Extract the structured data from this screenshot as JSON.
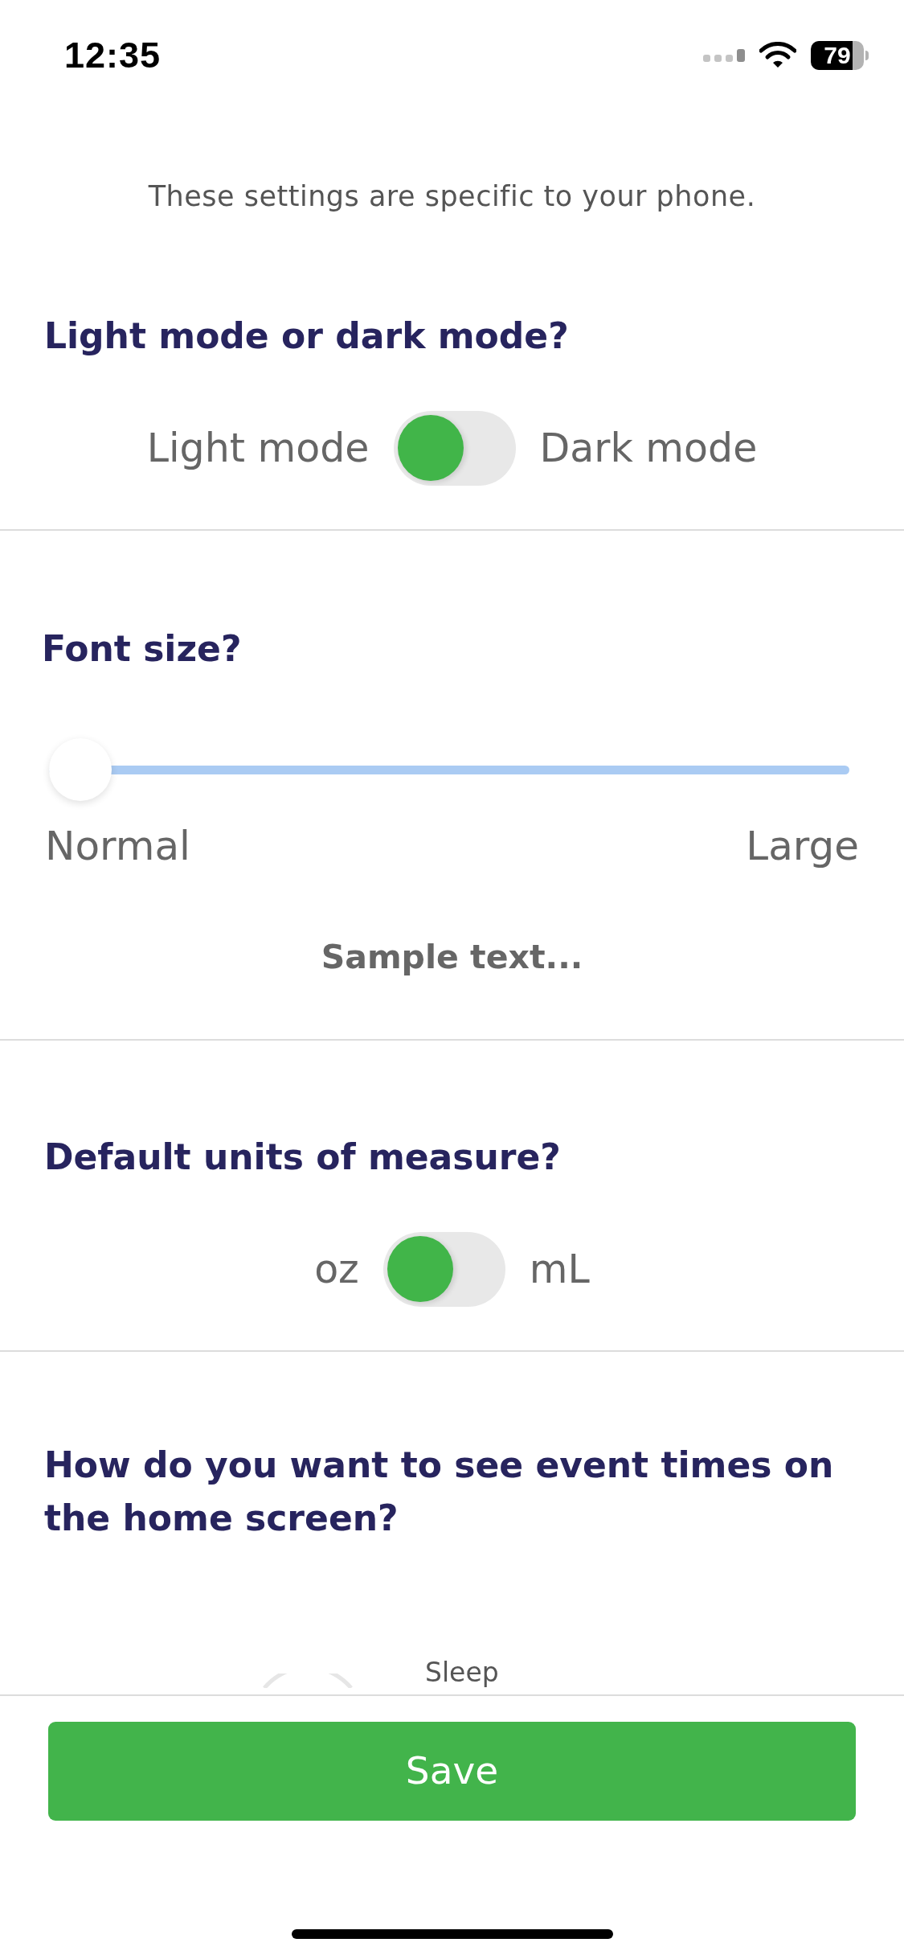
{
  "status_bar": {
    "time": "12:35",
    "battery": "79"
  },
  "intro": "These settings are specific to your phone.",
  "sections": [
    {
      "kind": "toggle",
      "heading": "Light mode or dark mode?",
      "left_label": "Light mode",
      "right_label": "Dark mode",
      "on": false
    },
    {
      "kind": "slider",
      "heading": "Font size?",
      "level": 0,
      "min_label": "Normal",
      "max_label": "Large",
      "sample": "Sample text..."
    },
    {
      "kind": "toggle",
      "heading": "Default units of measure?",
      "left_label": "oz",
      "right_label": "mL",
      "on": false
    },
    {
      "kind": "options",
      "heading": "How do you want to see event times on the home screen?",
      "option_label": "Sleep"
    }
  ],
  "save_button": "Save"
}
